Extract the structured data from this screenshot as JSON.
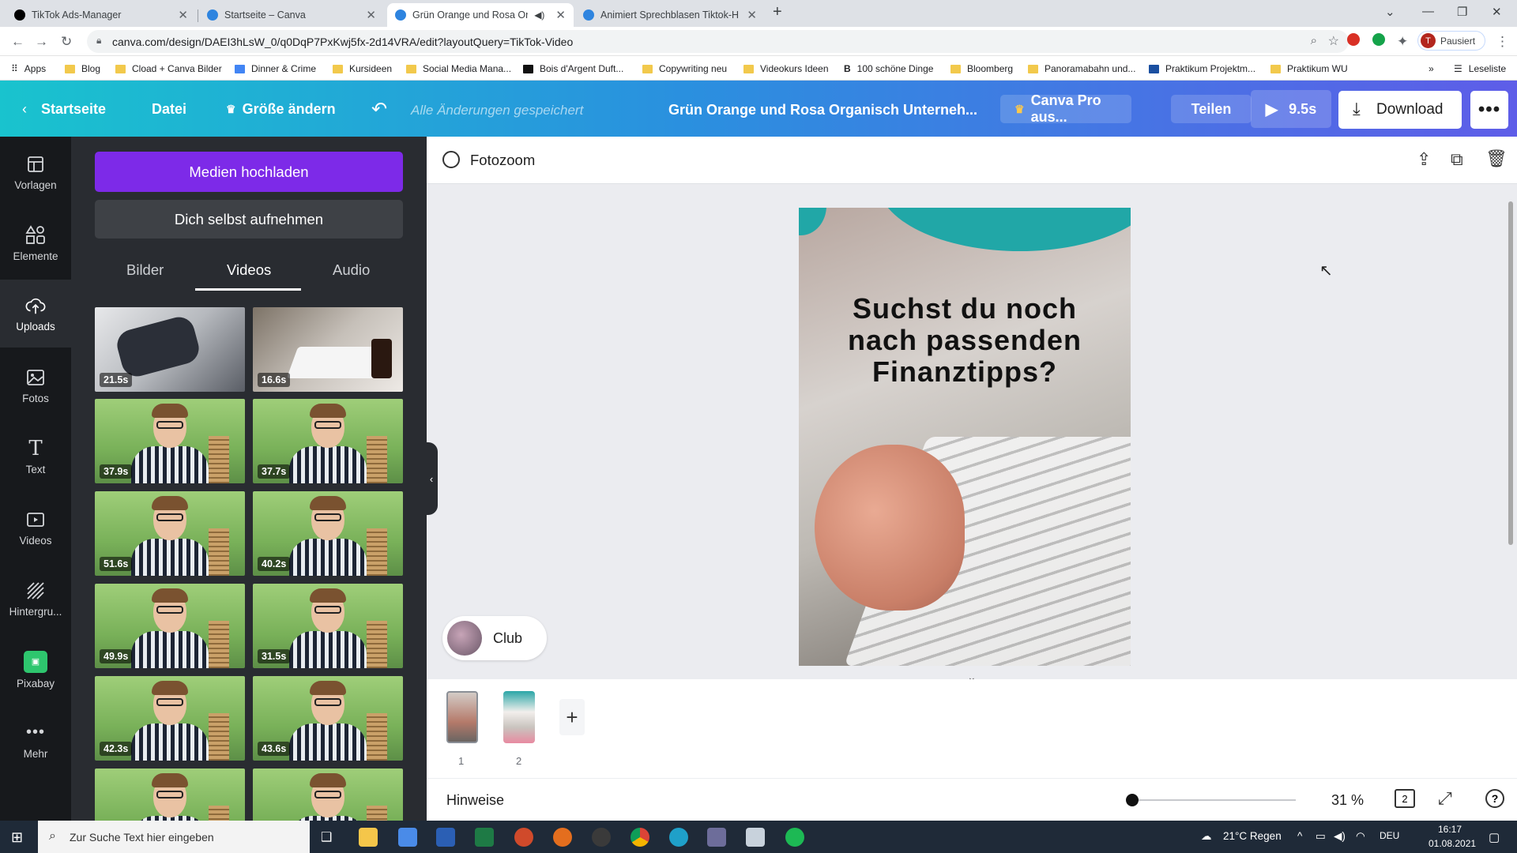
{
  "browser": {
    "tabs": [
      {
        "title": "TikTok Ads-Manager",
        "active": false,
        "icon": "tiktok-icon"
      },
      {
        "title": "Startseite – Canva",
        "active": false,
        "icon": "canva-icon"
      },
      {
        "title": "Grün Orange und Rosa Orga",
        "active": true,
        "icon": "canva-icon"
      },
      {
        "title": "Animiert Sprechblasen Tiktok-H",
        "active": false,
        "icon": "canva-icon"
      }
    ],
    "url": "canva.com/design/DAEI3hLsW_0/q0DqP7PxKwj5fx-2d14VRA/edit?layoutQuery=TikTok-Video",
    "profile_initial": "T",
    "profile_label": "Pausiert",
    "bookmarks": [
      "Apps",
      "Blog",
      "Cload + Canva Bilder",
      "Dinner & Crime",
      "Kursideen",
      "Social Media Mana...",
      "Bois d'Argent Duft...",
      "Copywriting neu",
      "Videokurs Ideen",
      "100 schöne Dinge",
      "Bloomberg",
      "Panoramabahn und...",
      "Praktikum Projektm...",
      "Praktikum WU"
    ],
    "reading_list": "Leseliste"
  },
  "header": {
    "home": "Startseite",
    "file": "Datei",
    "resize": "Größe ändern",
    "saved": "Alle Änderungen gespeichert",
    "doc_title": "Grün Orange und Rosa Organisch Unterneh...",
    "pro": "Canva Pro aus...",
    "share": "Teilen",
    "play": "9.5s",
    "download": "Download"
  },
  "rail": [
    {
      "label": "Vorlagen",
      "icon": "templates-icon"
    },
    {
      "label": "Elemente",
      "icon": "elements-icon"
    },
    {
      "label": "Uploads",
      "icon": "upload-cloud-icon",
      "active": true
    },
    {
      "label": "Fotos",
      "icon": "photo-icon"
    },
    {
      "label": "Text",
      "icon": "text-icon"
    },
    {
      "label": "Videos",
      "icon": "video-icon"
    },
    {
      "label": "Hintergru...",
      "icon": "background-icon"
    },
    {
      "label": "Pixabay",
      "icon": "pixabay-icon"
    },
    {
      "label": "Mehr",
      "icon": "more-icon"
    }
  ],
  "panel": {
    "upload_btn": "Medien hochladen",
    "record_btn": "Dich selbst aufnehmen",
    "tabs": [
      "Bilder",
      "Videos",
      "Audio"
    ],
    "active_tab": "Videos",
    "videos": [
      "21.5s",
      "16.6s",
      "37.9s",
      "37.7s",
      "51.6s",
      "40.2s",
      "49.9s",
      "31.5s",
      "42.3s",
      "43.6s",
      "",
      ""
    ]
  },
  "editor": {
    "toolbar_label": "Fotozoom",
    "headline": "Suchst du noch nach passenden Finanztipps?",
    "chip_label": "Club",
    "pages": [
      "1",
      "2"
    ],
    "notes": "Hinweise",
    "zoom": "31 %",
    "zoom_fraction": 0.0,
    "page_count": "2"
  },
  "taskbar": {
    "search_placeholder": "Zur Suche Text hier eingeben",
    "weather": "21°C  Regen",
    "lang": "DEU",
    "time": "16:17",
    "date": "01.08.2021"
  }
}
